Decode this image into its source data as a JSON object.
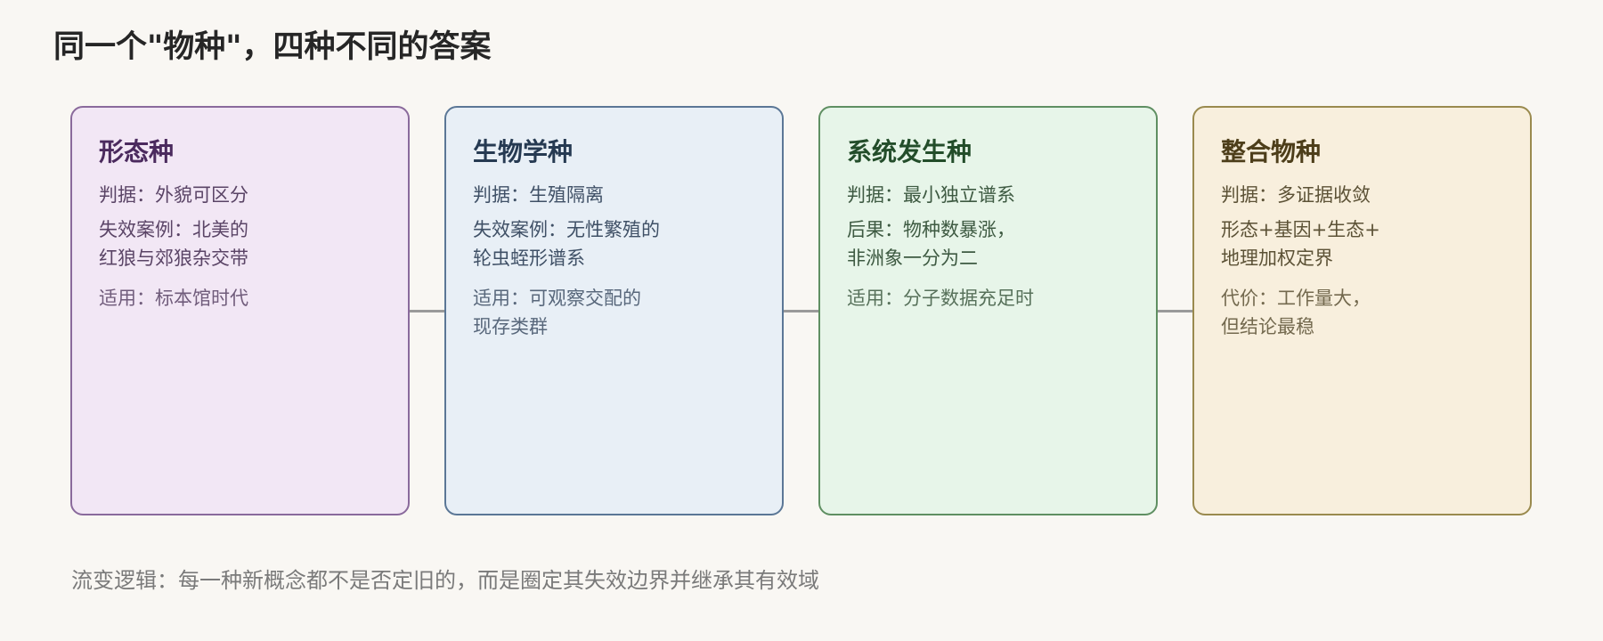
{
  "title": "同一个\"物种\"，四种不同的答案",
  "cards": [
    {
      "title": "形态种",
      "criterion": "判据：外貌可区分",
      "detail": "失效案例：北美的\n红狼与郊狼杂交带",
      "note": "适用：标本馆时代",
      "colors": {
        "bg": "#f2e7f5",
        "border": "#8a6a9c",
        "title": "#4b2a5e",
        "text": "#5a4466"
      }
    },
    {
      "title": "生物学种",
      "criterion": "判据：生殖隔离",
      "detail": "失效案例：无性繁殖的\n轮虫蛭形谱系",
      "note": "适用：可观察交配的\n现存类群",
      "colors": {
        "bg": "#e8eff6",
        "border": "#5b7796",
        "title": "#263a52",
        "text": "#3f5066"
      }
    },
    {
      "title": "系统发生种",
      "criterion": "判据：最小独立谱系",
      "detail": "后果：物种数暴涨，\n非洲象一分为二",
      "note": "适用：分子数据充足时",
      "colors": {
        "bg": "#e7f5e9",
        "border": "#5f8f62",
        "title": "#234d2a",
        "text": "#3e5a42"
      }
    },
    {
      "title": "整合物种",
      "criterion": "判据：多证据收敛",
      "detail": "形态+基因+生态+\n地理加权定界",
      "note": "代价：工作量大，\n但结论最稳",
      "colors": {
        "bg": "#f8efdd",
        "border": "#9a8a4e",
        "title": "#4d3e1a",
        "text": "#5c5236"
      }
    }
  ],
  "footer": "流变逻辑：每一种新概念都不是否定旧的，而是圈定其失效边界并继承其有效域"
}
